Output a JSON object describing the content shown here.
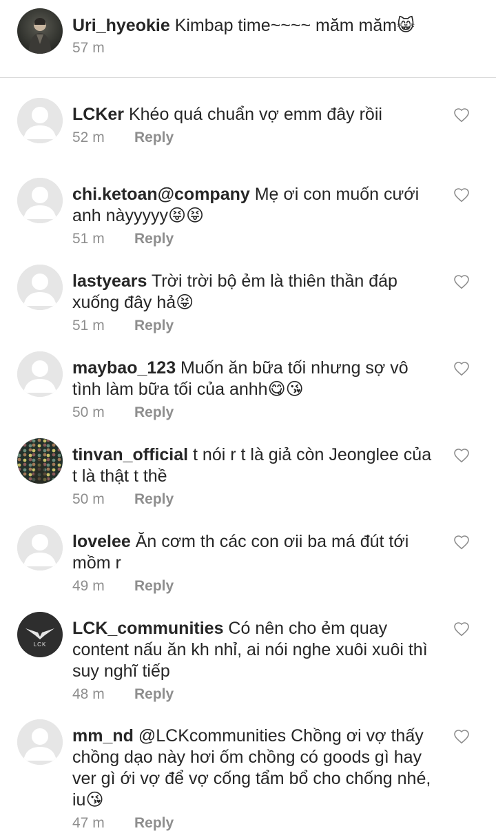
{
  "caption": {
    "username": "Uri_hyeokie",
    "text": "Kimbap time~~~~ măm măm😸",
    "time": "57 m"
  },
  "reply_label": "Reply",
  "colors": {
    "text": "#262626",
    "meta": "#8e8e8e",
    "divider": "#dbdbdb",
    "placeholder_avatar": "#e6e6e6"
  },
  "comments": [
    {
      "username": "LCKer",
      "text": "Khéo quá chuẩn vợ emm đây rồii",
      "time": "52 m",
      "avatar": "default-avatar"
    },
    {
      "username": "chi.ketoan@company",
      "text": "Mẹ ơi con muốn cưới anh nàyyyyy😝😝",
      "time": "51 m",
      "avatar": "default-avatar"
    },
    {
      "username": "lastyears",
      "text": "Trời trời bộ ẻm là thiên thần đáp xuống đây hả😝",
      "time": "51 m",
      "avatar": "default-avatar"
    },
    {
      "username": "maybao_123",
      "text": "Muốn ăn bữa tối nhưng sợ vô tình làm bữa tối của anhh😋😘",
      "time": "50 m",
      "avatar": "default-avatar"
    },
    {
      "username": "tinvan_official",
      "text": "t nói r t là giả còn Jeonglee của t là thật t thề",
      "time": "50 m",
      "avatar": "photo-avatar"
    },
    {
      "username": "lovelee",
      "text": "Ăn cơm th các con ơii ba má đút tới mồm r",
      "time": "49 m",
      "avatar": "default-avatar"
    },
    {
      "username": "LCK_communities",
      "text": "Có nên cho ẻm quay content nấu ăn kh nhỉ, ai nói nghe xuôi xuôi thì suy nghĩ tiếp",
      "time": "48 m",
      "avatar": "lck-logo-avatar",
      "logo_text": "LCK"
    },
    {
      "username": "mm_nd",
      "text": "@LCKcommunities Chồng ơi vợ thấy chồng dạo này hơi ốm chồng có goods gì hay ver gì ới vợ để vợ cống tẩm bổ cho chống nhé, iu😘",
      "time": "47 m",
      "avatar": "default-avatar"
    }
  ]
}
